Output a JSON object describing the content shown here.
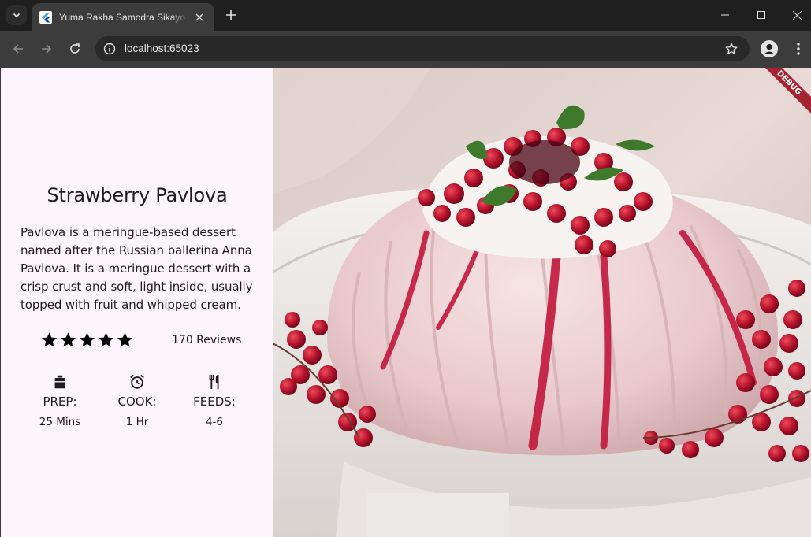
{
  "browser": {
    "tab_title": "Yuma Rakha Samodra Sikayo - Jumaat Fiber Demo",
    "url": "localhost:65023",
    "icons": {
      "tab_search": "chevron-down-icon",
      "favicon": "flutter-icon",
      "tab_close": "close-icon",
      "new_tab": "plus-icon",
      "minimize": "minimize-icon",
      "maximize": "maximize-icon",
      "close": "close-icon",
      "back": "arrow-left-icon",
      "forward": "arrow-right-icon",
      "reload": "reload-icon",
      "site_info": "info-icon",
      "bookmark": "star-outline-icon",
      "profile": "person-icon",
      "menu": "kebab-icon"
    }
  },
  "recipe": {
    "title": "Strawberry Pavlova",
    "description": "Pavlova is a meringue-based dessert named after the Russian ballerina Anna Pavlova. It is a meringue dessert with a crisp crust and soft, light inside, usually topped with fruit and whipped cream.",
    "rating_stars": 5,
    "reviews": "170 Reviews",
    "info": [
      {
        "icon": "kitchen-icon",
        "label": "PREP:",
        "value": "25 Mins"
      },
      {
        "icon": "alarm-icon",
        "label": "COOK:",
        "value": "1 Hr"
      },
      {
        "icon": "restaurant-icon",
        "label": "FEEDS:",
        "value": "4-6"
      }
    ]
  },
  "debug_banner": "DEBUG",
  "colors": {
    "panel_bg": "#fdf6fd",
    "text": "#1d1b20",
    "chrome_dark": "#1f1f1f",
    "chrome_toolbar": "#3c3c3c",
    "debug_red": "#a4242f"
  }
}
